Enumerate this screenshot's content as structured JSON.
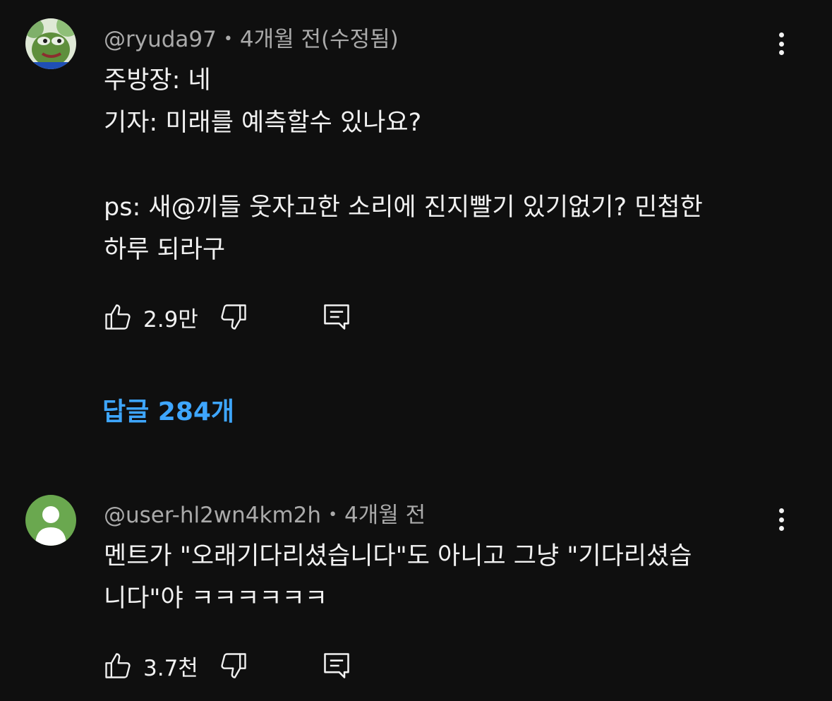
{
  "comments": [
    {
      "author": "@ryuda97",
      "separator": "•",
      "time": "4개월 전(수정됨)",
      "avatar_icon": "frog-avatar-icon",
      "lines": [
        "주방장: 네",
        "기자: 미래를 예측할수 있나요?",
        "",
        "ps: 새@끼들 웃자고한 소리에 진지빨기 있기없기? 민첩한",
        "하루 되라구"
      ],
      "likes": "2.9만",
      "replies_label": "답글 284개"
    },
    {
      "author": "@user-hl2wn4km2h",
      "separator": "•",
      "time": "4개월 전",
      "avatar_icon": "default-user-avatar-icon",
      "lines": [
        "멘트가 \"오래기다리셨습니다\"도 아니고 그냥 \"기다리셨습",
        "니다\"야 ㅋㅋㅋㅋㅋㅋ"
      ],
      "likes": "3.7천"
    }
  ],
  "colors": {
    "background": "#0f0f0f",
    "text": "#f1f1f1",
    "secondary_text": "#aaaaaa",
    "link": "#3ea6ff",
    "default_avatar": "#6aa84f"
  }
}
